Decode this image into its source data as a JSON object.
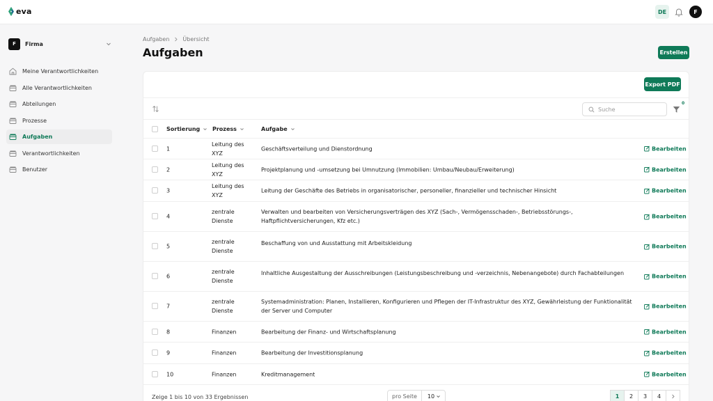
{
  "app": {
    "logo_text": "eva",
    "lang": "DE",
    "user_initial": "F"
  },
  "sidebar": {
    "company": {
      "initial": "F",
      "name": "Firma"
    },
    "items": [
      {
        "label": "Meine Verantwortlichkeiten",
        "icon": "home-icon",
        "active": false
      },
      {
        "label": "Alle Verantwortlichkeiten",
        "icon": "folder-icon",
        "active": false
      },
      {
        "label": "Abteilungen",
        "icon": "folder-icon",
        "active": false
      },
      {
        "label": "Prozesse",
        "icon": "folder-icon",
        "active": false
      },
      {
        "label": "Aufgaben",
        "icon": "folder-icon",
        "active": true
      },
      {
        "label": "Verantwortlichkeiten",
        "icon": "folder-icon",
        "active": false
      },
      {
        "label": "Benutzer",
        "icon": "folder-icon",
        "active": false
      }
    ]
  },
  "header": {
    "breadcrumb": [
      "Aufgaben",
      "Übersicht"
    ],
    "title": "Aufgaben",
    "create_label": "Erstellen"
  },
  "card": {
    "export_label": "Export PDF",
    "search_placeholder": "Suche",
    "filter_count": "0"
  },
  "table": {
    "columns": [
      "Sortierung",
      "Prozess",
      "Aufgabe"
    ],
    "edit_label": "Bearbeiten",
    "rows": [
      {
        "num": "1",
        "process": "Leitung des XYZ",
        "task": "Geschäftsverteilung und Dienstordnung"
      },
      {
        "num": "2",
        "process": "Leitung des XYZ",
        "task": "Projektplanung und -umsetzung bei Umnutzung (Immobilien: Umbau/Neubau/Erweiterung)"
      },
      {
        "num": "3",
        "process": "Leitung des XYZ",
        "task": "Leitung der Geschäfte des Betriebs in organisatorischer, personeller, finanzieller und technischer Hinsicht"
      },
      {
        "num": "4",
        "process": "zentrale Dienste",
        "task": "Verwalten und bearbeiten von Versicherungsverträgen des XYZ (Sach-, Vermögensschaden-, Betriebsstörungs-, Haftpflichtversicherungen, Kfz etc.)"
      },
      {
        "num": "5",
        "process": "zentrale Dienste",
        "task": "Beschaffung von und Ausstattung mit Arbeitskleidung"
      },
      {
        "num": "6",
        "process": "zentrale Dienste",
        "task": "Inhaltliche Ausgestaltung der Ausschreibungen (Leistungsbeschreibung und -verzeichnis, Nebenangebote) durch Fachabteilungen"
      },
      {
        "num": "7",
        "process": "zentrale Dienste",
        "task": "Systemadministration: Planen, Installieren, Konfigurieren und Pflegen der IT-Infrastruktur des XYZ, Gewährleistung der Funktionalität der Server und Computer"
      },
      {
        "num": "8",
        "process": "Finanzen",
        "task": "Bearbeitung der Finanz- und Wirtschaftsplanung"
      },
      {
        "num": "9",
        "process": "Finanzen",
        "task": "Bearbeitung der Investitionsplanung"
      },
      {
        "num": "10",
        "process": "Finanzen",
        "task": "Kreditmanagement"
      }
    ]
  },
  "footer": {
    "result_text": "Zeige 1 bis 10 von 33 Ergebnissen",
    "per_page_label": "pro Seite",
    "per_page_value": "10",
    "pages": [
      "1",
      "2",
      "3",
      "4"
    ],
    "current_page": "1"
  },
  "colors": {
    "accent": "#0f7a58",
    "accent_light": "#e6f3ee"
  }
}
